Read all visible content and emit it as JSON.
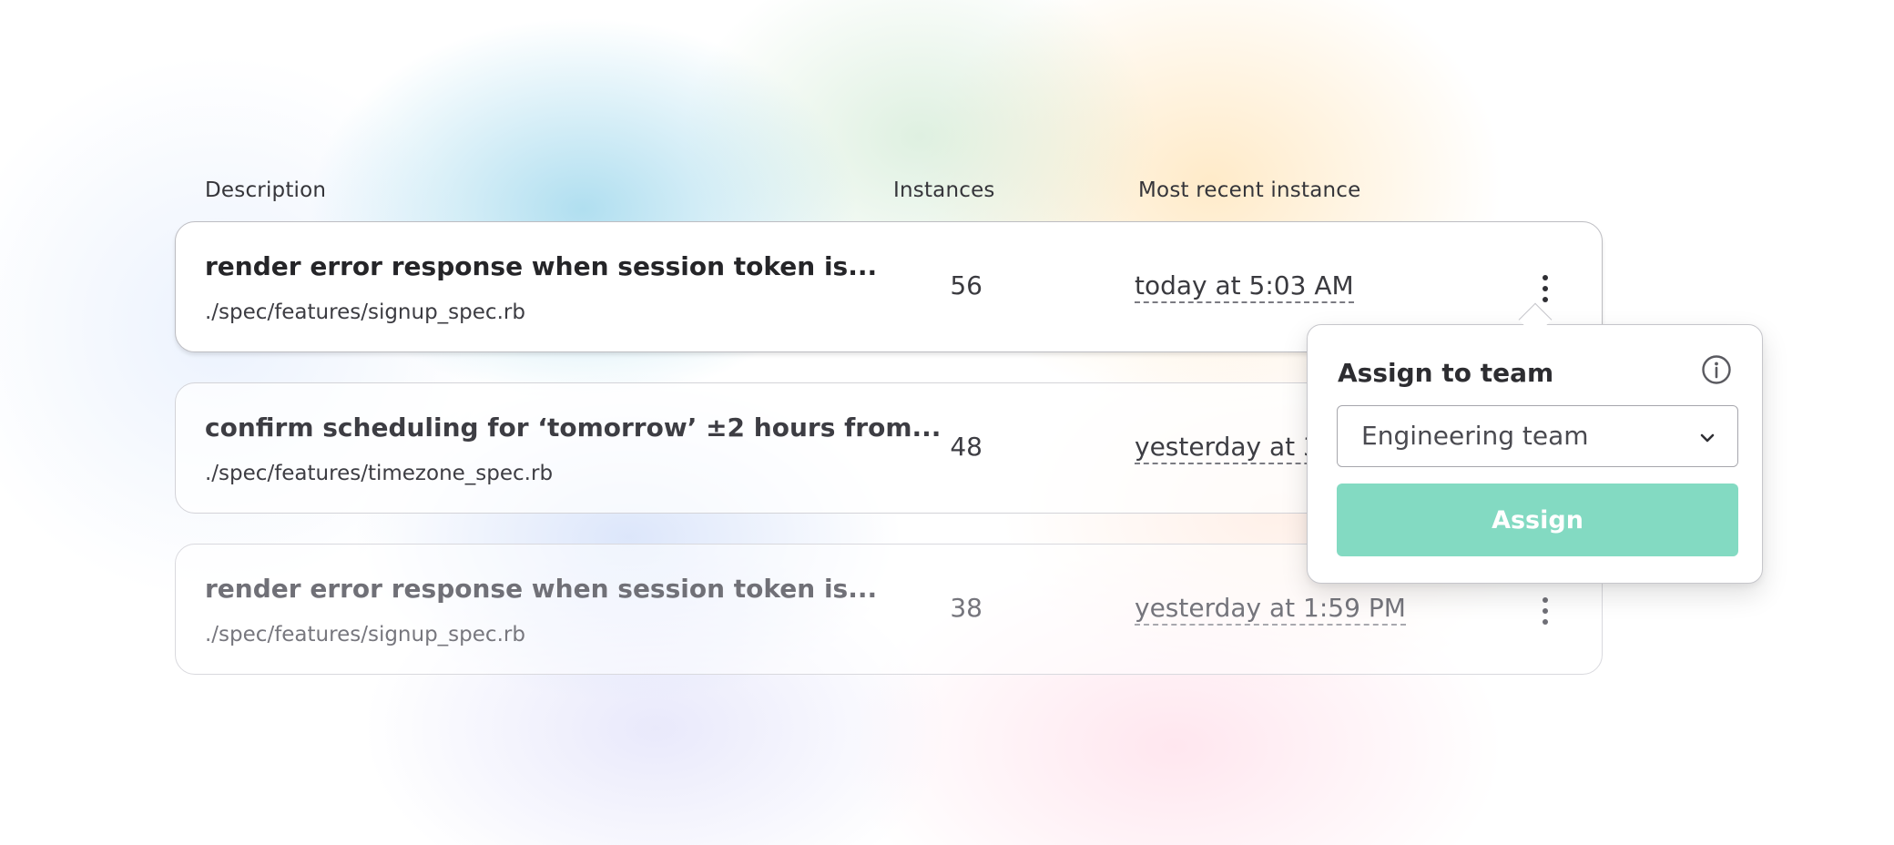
{
  "columns": {
    "description": "Description",
    "instances": "Instances",
    "recent": "Most recent instance"
  },
  "rows": [
    {
      "title": "render error response when session token is...",
      "path": "./spec/features/signup_spec.rb",
      "instances": "56",
      "recent": "today at 5:03 AM"
    },
    {
      "title": "confirm scheduling for ‘tomorrow’ ±2 hours from...",
      "path": "./spec/features/timezone_spec.rb",
      "instances": "48",
      "recent": "yesterday at 3:"
    },
    {
      "title": "render error response when session token is...",
      "path": "./spec/features/signup_spec.rb",
      "instances": "38",
      "recent": "yesterday at 1:59 PM"
    }
  ],
  "popover": {
    "title": "Assign to team",
    "info_icon": "info-icon",
    "select_value": "Engineering team",
    "select_icon": "chevron-down-icon",
    "button_label": "Assign"
  },
  "colors": {
    "assign_button": "#83dac2",
    "row_border": "#bdbdc2",
    "text": "#2b2b2f"
  }
}
